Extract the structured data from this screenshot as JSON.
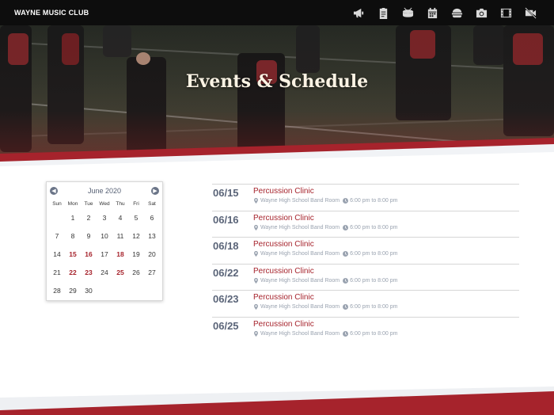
{
  "nav": {
    "brand": "WAYNE MUSIC CLUB",
    "icons": [
      "megaphone-icon",
      "clipboard-icon",
      "drum-icon",
      "calendar-icon",
      "hamburger-icon",
      "camera-icon",
      "film-icon",
      "video-off-icon"
    ]
  },
  "hero": {
    "title": "Events & Schedule"
  },
  "colors": {
    "accent": "#a6232c",
    "date_text": "#5a6478",
    "meta_text": "#9aa3b0",
    "nav_bg": "#0d0d0d"
  },
  "calendar": {
    "month": "June 2020",
    "weekdays": [
      "Sun",
      "Mon",
      "Tue",
      "Wed",
      "Thu",
      "Fri",
      "Sat"
    ],
    "weeks": [
      [
        "",
        "1",
        "2",
        "3",
        "4",
        "5",
        "6"
      ],
      [
        "7",
        "8",
        "9",
        "10",
        "11",
        "12",
        "13"
      ],
      [
        "14",
        "15",
        "16",
        "17",
        "18",
        "19",
        "20"
      ],
      [
        "21",
        "22",
        "23",
        "24",
        "25",
        "26",
        "27"
      ],
      [
        "28",
        "29",
        "30",
        "",
        "",
        "",
        ""
      ]
    ],
    "event_days": [
      "15",
      "16",
      "18",
      "22",
      "23",
      "25"
    ]
  },
  "events": [
    {
      "date": "06/15",
      "title": "Percussion Clinic",
      "location": "Wayne High School Band Room",
      "time": "6:00 pm to 8:00 pm"
    },
    {
      "date": "06/16",
      "title": "Percussion Clinic",
      "location": "Wayne High School Band Room",
      "time": "6:00 pm to 8:00 pm"
    },
    {
      "date": "06/18",
      "title": "Percussion Clinic",
      "location": "Wayne High School Band Room",
      "time": "6:00 pm to 8:00 pm"
    },
    {
      "date": "06/22",
      "title": "Percussion Clinic",
      "location": "Wayne High School Band Room",
      "time": "6:00 pm to 8:00 pm"
    },
    {
      "date": "06/23",
      "title": "Percussion Clinic",
      "location": "Wayne High School Band Room",
      "time": "6:00 pm to 8:00 pm"
    },
    {
      "date": "06/25",
      "title": "Percussion Clinic",
      "location": "Wayne High School Band Room",
      "time": "6:00 pm to 8:00 pm"
    }
  ]
}
